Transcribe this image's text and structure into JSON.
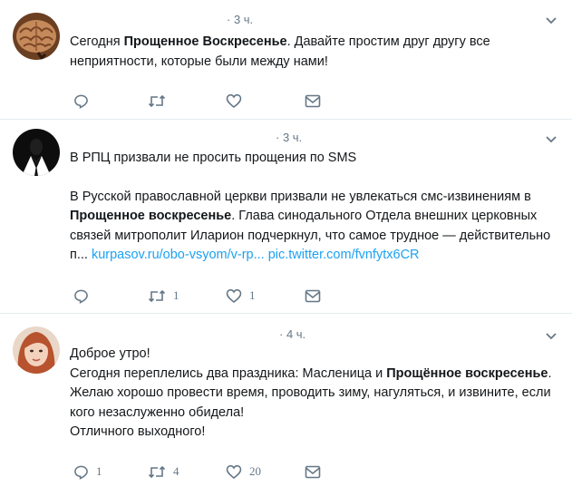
{
  "tweets": [
    {
      "time": "· 3 ч.",
      "avatar": "brain-avatar",
      "paragraphs": [
        [
          {
            "t": "Сегодня ",
            "b": false
          },
          {
            "t": "Прощенное Воскресенье",
            "b": true
          },
          {
            "t": ". Давайте простим друг другу все неприятности, которые были между нами!",
            "b": false
          }
        ]
      ],
      "counts": {
        "reply": "",
        "retweet": "",
        "like": ""
      }
    },
    {
      "time": "· 3 ч.",
      "avatar": "suit-avatar",
      "paragraphs": [
        [
          {
            "t": "В РПЦ призвали не просить прощения по SMS",
            "b": false
          }
        ],
        [
          {
            "t": "В Русской православной церкви призвали не увлекаться смс-извинениям в ",
            "b": false
          },
          {
            "t": "Прощенное воскресенье",
            "b": true
          },
          {
            "t": ". Глава синодального Отдела внешних церковных связей митрополит Иларион подчеркнул, что самое трудное — действительно п... ",
            "b": false
          },
          {
            "t": "kurpasov.ru/obo-vsyom/v-rp...",
            "b": false,
            "link": true
          },
          {
            "t": "  ",
            "b": false
          },
          {
            "t": "pic.twitter.com/fvnfytx6CR",
            "b": false,
            "link": true
          }
        ]
      ],
      "counts": {
        "reply": "",
        "retweet": "1",
        "like": "1"
      }
    },
    {
      "time": "· 4 ч.",
      "avatar": "woman-avatar",
      "paragraphs": [
        [
          {
            "t": "Доброе утро!",
            "b": false
          }
        ],
        [
          {
            "t": "Сегодня переплелись два праздника: Масленица и ",
            "b": false
          },
          {
            "t": "Прощённое воскресенье",
            "b": true
          },
          {
            "t": ".",
            "b": false
          }
        ],
        [
          {
            "t": "Желаю хорошо провести время, проводить зиму, нагуляться, и извините, если кого незаслуженно обидела!",
            "b": false
          }
        ],
        [
          {
            "t": "Отличного выходного!",
            "b": false
          }
        ]
      ],
      "counts": {
        "reply": "1",
        "retweet": "4",
        "like": "20"
      }
    }
  ]
}
